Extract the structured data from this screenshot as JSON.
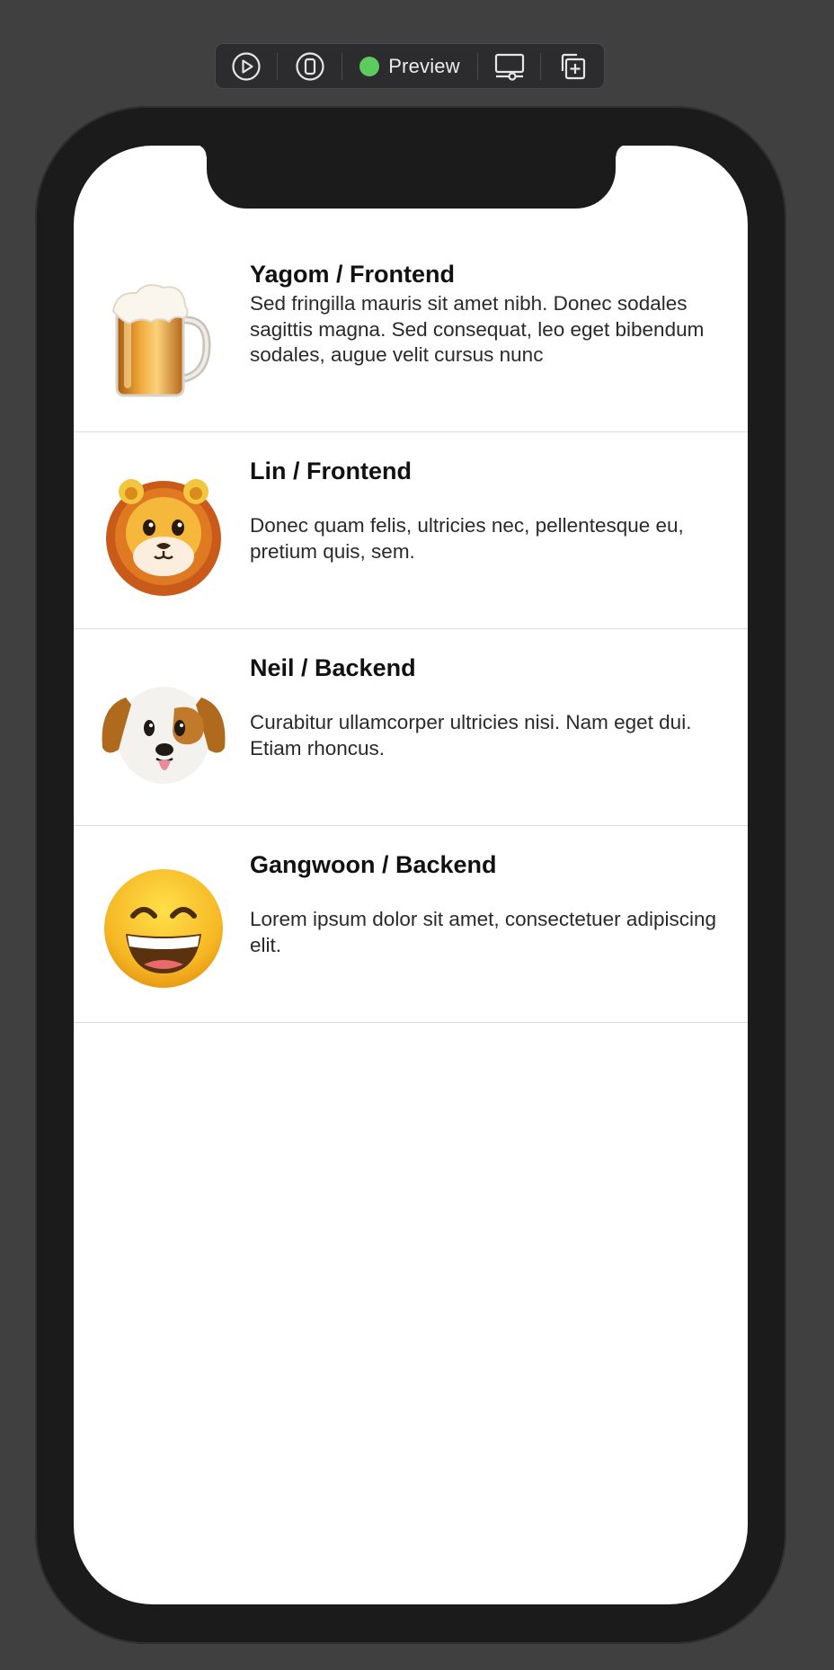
{
  "toolbar": {
    "preview_label": "Preview",
    "status_color": "#5ecb5e",
    "icons": [
      "play-circle-icon",
      "device-icon",
      "display-settings-icon",
      "duplicate-icon"
    ]
  },
  "list": {
    "rows": [
      {
        "title": "Yagom / Frontend",
        "description": "Sed fringilla mauris sit amet nibh. Donec sodales sagittis magna. Sed consequat, leo eget bibendum sodales, augue velit cursus nunc",
        "icon": "beer-mug-icon"
      },
      {
        "title": "Lin / Frontend",
        "description": "Donec quam felis, ultricies nec, pellentesque eu, pretium quis, sem.",
        "icon": "lion-face-icon"
      },
      {
        "title": "Neil / Backend",
        "description": "Curabitur ullamcorper ultricies nisi. Nam eget dui. Etiam rhoncus.",
        "icon": "puppy-face-icon"
      },
      {
        "title": "Gangwoon / Backend",
        "description": "Lorem ipsum dolor sit amet, consectetuer adipiscing elit.",
        "icon": "grinning-face-icon"
      }
    ]
  }
}
